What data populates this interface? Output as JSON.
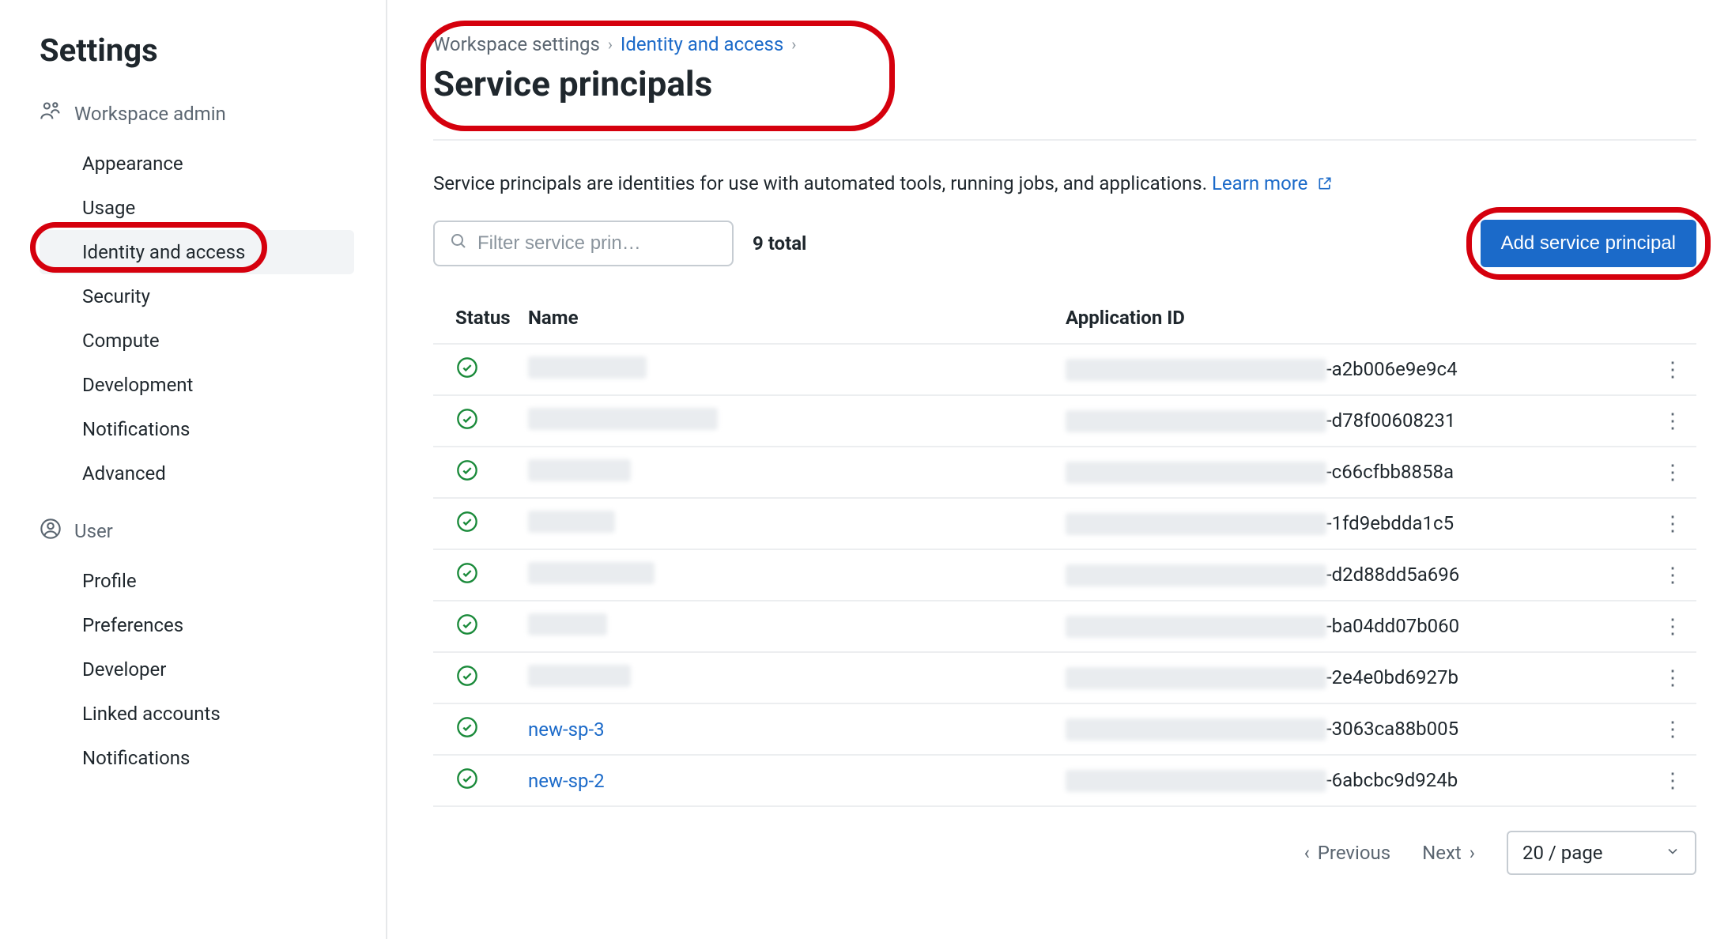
{
  "sidebar": {
    "title": "Settings",
    "sections": [
      {
        "label": "Workspace admin",
        "icon": "workspace-admin-icon",
        "items": [
          {
            "label": "Appearance",
            "active": false
          },
          {
            "label": "Usage",
            "active": false
          },
          {
            "label": "Identity and access",
            "active": true
          },
          {
            "label": "Security",
            "active": false
          },
          {
            "label": "Compute",
            "active": false
          },
          {
            "label": "Development",
            "active": false
          },
          {
            "label": "Notifications",
            "active": false
          },
          {
            "label": "Advanced",
            "active": false
          }
        ]
      },
      {
        "label": "User",
        "icon": "user-icon",
        "items": [
          {
            "label": "Profile",
            "active": false
          },
          {
            "label": "Preferences",
            "active": false
          },
          {
            "label": "Developer",
            "active": false
          },
          {
            "label": "Linked accounts",
            "active": false
          },
          {
            "label": "Notifications",
            "active": false
          }
        ]
      }
    ]
  },
  "breadcrumb": {
    "root": "Workspace settings",
    "parent": "Identity and access"
  },
  "page": {
    "title": "Service principals",
    "description": "Service principals are identities for use with automated tools, running jobs, and applications.",
    "learn_more": "Learn more"
  },
  "toolbar": {
    "filter_placeholder": "Filter service prin…",
    "total_label": "9 total",
    "add_button": "Add service principal"
  },
  "table": {
    "columns": {
      "status": "Status",
      "name": "Name",
      "app_id": "Application ID"
    },
    "rows": [
      {
        "status": "active",
        "name_redacted": true,
        "name": "",
        "app_id_prefix_redacted": true,
        "app_id_suffix": "-a2b006e9e9c4"
      },
      {
        "status": "active",
        "name_redacted": true,
        "name": "",
        "app_id_prefix_redacted": true,
        "app_id_suffix": "-d78f00608231"
      },
      {
        "status": "active",
        "name_redacted": true,
        "name": "",
        "app_id_prefix_redacted": true,
        "app_id_suffix": "-c66cfbb8858a"
      },
      {
        "status": "active",
        "name_redacted": true,
        "name": "",
        "app_id_prefix_redacted": true,
        "app_id_suffix": "-1fd9ebdda1c5"
      },
      {
        "status": "active",
        "name_redacted": true,
        "name": "",
        "app_id_prefix_redacted": true,
        "app_id_suffix": "-d2d88dd5a696"
      },
      {
        "status": "active",
        "name_redacted": true,
        "name": "",
        "app_id_prefix_redacted": true,
        "app_id_suffix": "-ba04dd07b060"
      },
      {
        "status": "active",
        "name_redacted": true,
        "name": "",
        "app_id_prefix_redacted": true,
        "app_id_suffix": "-2e4e0bd6927b"
      },
      {
        "status": "active",
        "name_redacted": false,
        "name": "new-sp-3",
        "app_id_prefix_redacted": true,
        "app_id_suffix": "-3063ca88b005"
      },
      {
        "status": "active",
        "name_redacted": false,
        "name": "new-sp-2",
        "app_id_prefix_redacted": true,
        "app_id_suffix": "-6abcbc9d924b"
      }
    ]
  },
  "pagination": {
    "previous": "Previous",
    "next": "Next",
    "page_size": "20 / page"
  },
  "redaction": {
    "name_widths": [
      150,
      240,
      130,
      110,
      160,
      100,
      130
    ],
    "appid_prefix_width": 330
  }
}
